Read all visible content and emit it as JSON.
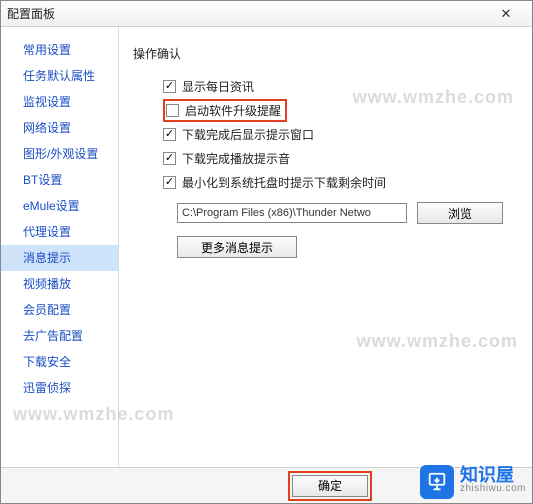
{
  "window": {
    "title": "配置面板",
    "close": "✕"
  },
  "sidebar": {
    "items": [
      {
        "label": "常用设置"
      },
      {
        "label": "任务默认属性"
      },
      {
        "label": "监视设置"
      },
      {
        "label": "网络设置"
      },
      {
        "label": "图形/外观设置"
      },
      {
        "label": "BT设置"
      },
      {
        "label": "eMule设置"
      },
      {
        "label": "代理设置"
      },
      {
        "label": "消息提示",
        "selected": true
      },
      {
        "label": "视频播放"
      },
      {
        "label": "会员配置"
      },
      {
        "label": "去广告配置"
      },
      {
        "label": "下载安全"
      },
      {
        "label": "迅雷侦探"
      }
    ]
  },
  "section": {
    "title": "操作确认",
    "options": [
      {
        "label": "显示每日资讯",
        "checked": true,
        "highlight": false
      },
      {
        "label": "启动软件升级提醒",
        "checked": false,
        "highlight": true
      },
      {
        "label": "下载完成后显示提示窗口",
        "checked": true,
        "highlight": false
      },
      {
        "label": "下载完成播放提示音",
        "checked": true,
        "highlight": false
      },
      {
        "label": "最小化到系统托盘时提示下载剩余时间",
        "checked": true,
        "highlight": false
      }
    ],
    "path_value": "C:\\Program Files (x86)\\Thunder Netwo",
    "browse_label": "浏览",
    "more_label": "更多消息提示"
  },
  "footer": {
    "ok": "确定"
  },
  "brand": {
    "cn": "知识屋",
    "domain": "zhishiwu.com"
  },
  "watermark": "www.wmzhe.com"
}
